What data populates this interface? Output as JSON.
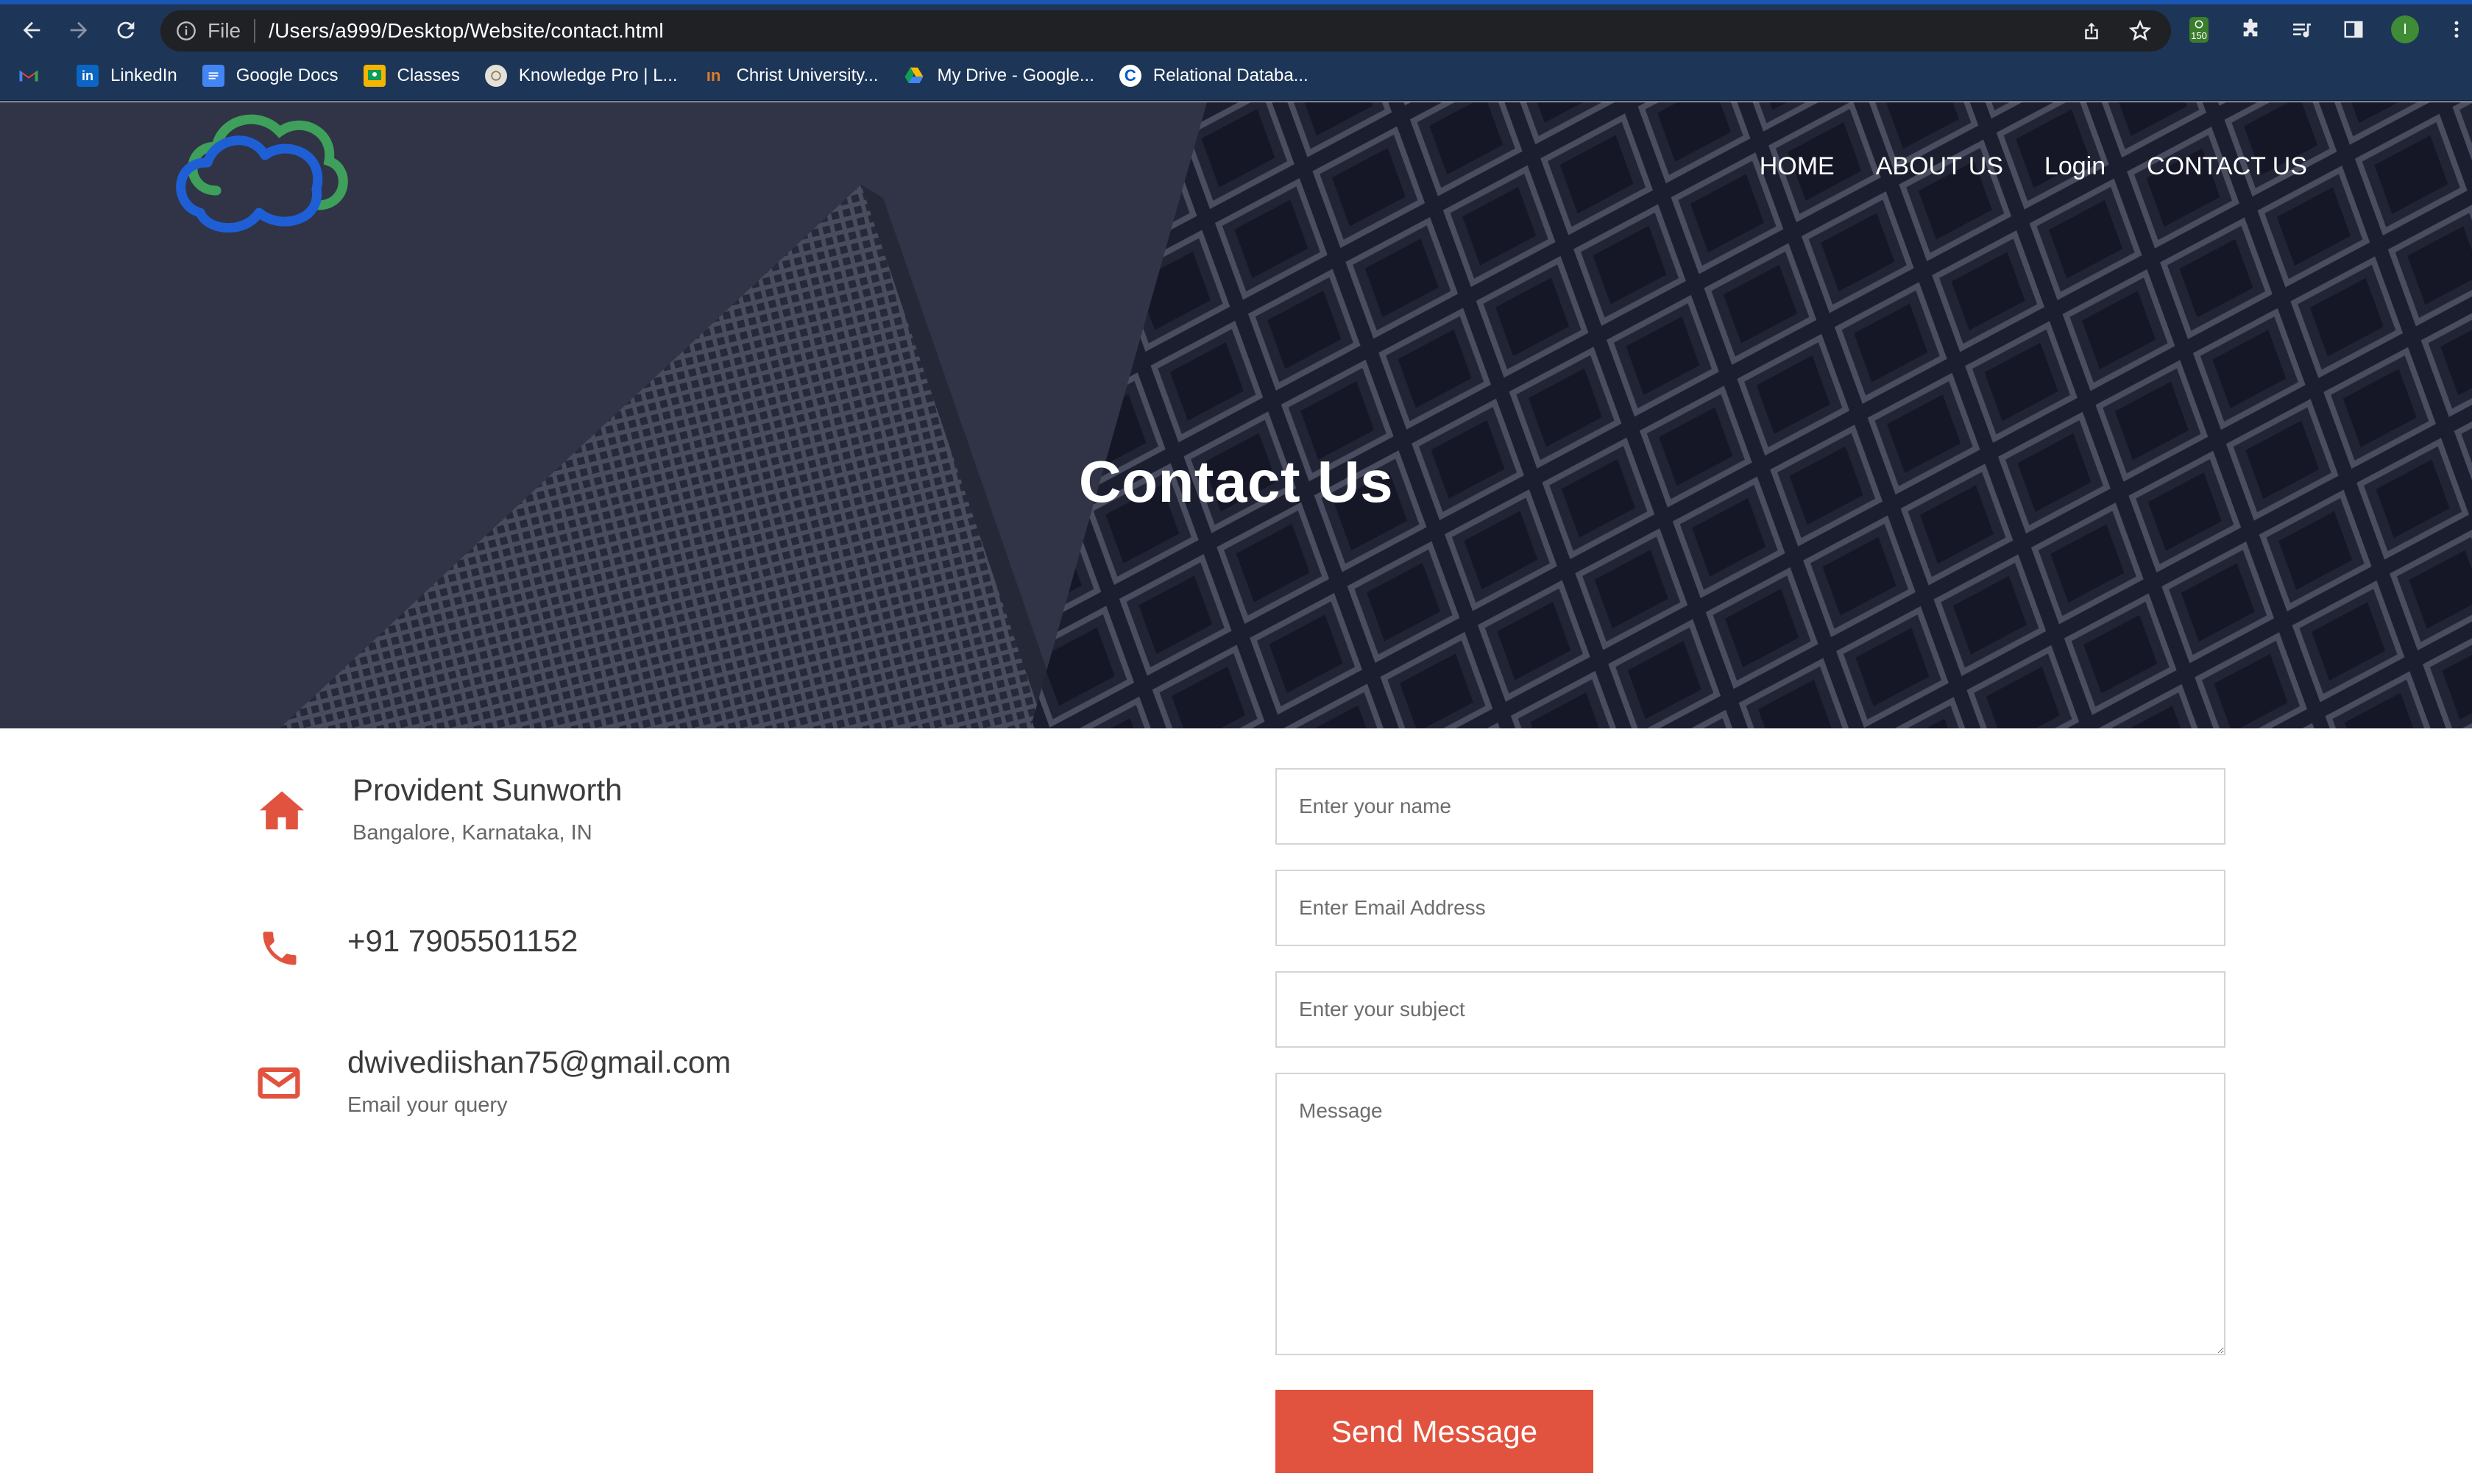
{
  "browser": {
    "scheme": "File",
    "url": "/Users/a999/Desktop/Website/contact.html",
    "extension_badge": "150",
    "profile_initial": "I",
    "bookmarks": [
      {
        "label": "",
        "icon": "gmail-icon"
      },
      {
        "label": "LinkedIn",
        "icon": "linkedin-icon"
      },
      {
        "label": "Google Docs",
        "icon": "google-docs-icon"
      },
      {
        "label": "Classes",
        "icon": "google-classroom-icon"
      },
      {
        "label": "Knowledge Pro | L...",
        "icon": "knowledge-pro-icon"
      },
      {
        "label": "Christ University...",
        "icon": "christ-university-icon"
      },
      {
        "label": "My Drive - Google...",
        "icon": "google-drive-icon"
      },
      {
        "label": "Relational Databa...",
        "icon": "coursera-icon"
      }
    ]
  },
  "site": {
    "nav": [
      "HOME",
      "ABOUT US",
      "Login",
      "CONTACT US"
    ],
    "hero_title": "Contact Us"
  },
  "contact": {
    "address": {
      "title": "Provident Sunworth",
      "sub": "Bangalore, Karnataka, IN"
    },
    "phone": {
      "title": "+91 7905501152"
    },
    "email": {
      "title": "dwivediishan75@gmail.com",
      "sub": "Email your query"
    }
  },
  "form": {
    "name_placeholder": "Enter your name",
    "email_placeholder": "Enter Email Address",
    "subject_placeholder": "Enter your subject",
    "message_placeholder": "Message",
    "submit_label": "Send Message"
  },
  "colors": {
    "accent": "#e2533f",
    "chrome": "#1d3557",
    "hero_overlay": "#2d3142"
  }
}
